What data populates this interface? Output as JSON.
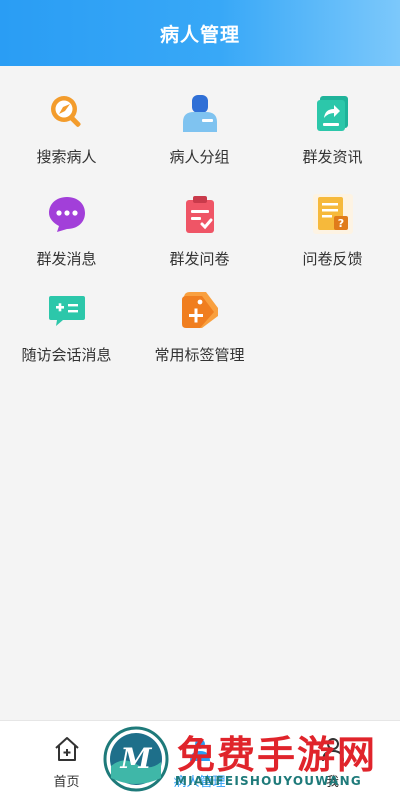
{
  "header": {
    "title": "病人管理"
  },
  "features": [
    {
      "label": "搜索病人",
      "icon": "search-patient-icon"
    },
    {
      "label": "病人分组",
      "icon": "patient-group-icon"
    },
    {
      "label": "群发资讯",
      "icon": "broadcast-news-icon"
    },
    {
      "label": "群发消息",
      "icon": "broadcast-message-icon"
    },
    {
      "label": "群发问卷",
      "icon": "broadcast-survey-icon"
    },
    {
      "label": "问卷反馈",
      "icon": "survey-feedback-icon"
    },
    {
      "label": "随访会话消息",
      "icon": "followup-chat-icon"
    },
    {
      "label": "常用标签管理",
      "icon": "tag-management-icon"
    }
  ],
  "tabbar": {
    "tabs": [
      {
        "label": "首页",
        "icon": "home-icon",
        "active": false
      },
      {
        "label": "病人管理",
        "icon": "patient-manage-icon",
        "active": true
      },
      {
        "label": "我",
        "icon": "me-icon",
        "active": false
      }
    ]
  },
  "watermark": {
    "title": "免费手游网",
    "subtitle": "MIANFEISHOUYOUWANG",
    "logo_letter": "M"
  },
  "colors": {
    "header": "#2a9df4",
    "active_tab": "#2a9df4",
    "watermark_red": "#e0242b"
  }
}
